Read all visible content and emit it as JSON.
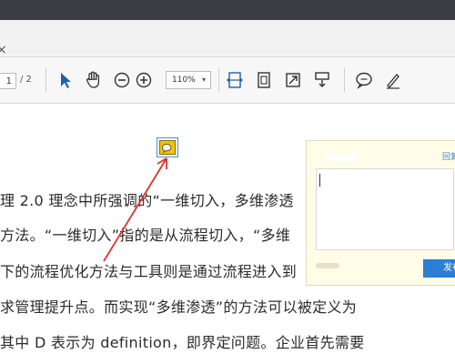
{
  "tab": {
    "close_glyph": "×"
  },
  "toolbar": {
    "page_current": "1",
    "page_total": "/ 2",
    "zoom_value": "110%",
    "zoom_caret": "▾",
    "icons": [
      "select-arrow-icon",
      "hand-icon",
      "zoom-out-icon",
      "zoom-in-icon",
      "fit-width-icon",
      "fit-page-icon",
      "full-screen-icon",
      "scroll-mode-icon",
      "comment-icon",
      "sign-icon"
    ]
  },
  "document": {
    "lines": [
      "理 2.0 理念中所强调的“一维切入，多维渗透",
      "方法。“一维切入”指的是从流程切入，“多维",
      "下的流程优化方法与工具则是通过流程进入到",
      "求管理提升点。而实现“多维渗透”的方法可以被定义为",
      "其中 D 表示为 definition，即界定问题。企业首先需要"
    ]
  },
  "comment_popup": {
    "reply_label": "回复",
    "post_label": "发布",
    "text_value": ""
  },
  "colors": {
    "accent": "#2a7ed3",
    "note_yellow": "#f4c20d",
    "arrow_red": "#e0302a",
    "popup_bg": "#fffde8"
  }
}
